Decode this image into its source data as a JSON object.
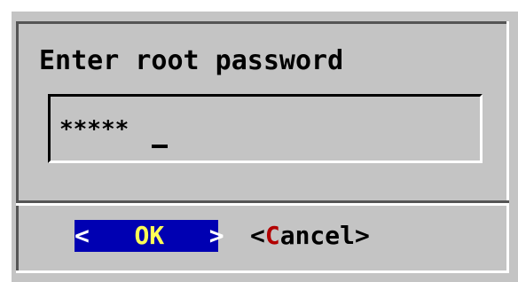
{
  "dialog": {
    "title": "Enter root password",
    "input": {
      "value": "*****"
    },
    "buttons": {
      "ok": {
        "left_bracket": "<",
        "hotkey": "O",
        "rest": "K",
        "right_bracket": ">"
      },
      "cancel": {
        "left_bracket": "<",
        "hotkey": "C",
        "rest": "ancel",
        "right_bracket": ">"
      }
    }
  },
  "colors": {
    "dialog_background": "#c4c4c4",
    "focused_button_background": "#0000b2",
    "focused_hotkey": "#ffff55",
    "hotkey": "#b20000",
    "text": "#000000"
  }
}
